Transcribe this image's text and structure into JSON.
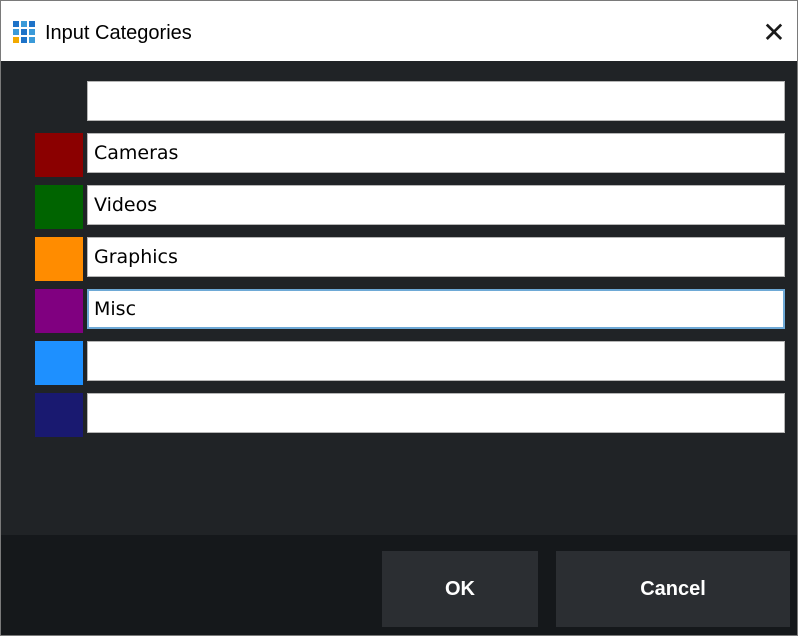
{
  "window": {
    "title": "Input Categories",
    "close_glyph": "✕",
    "icon": "grid-icon",
    "icon_colors": [
      "#1e73c8",
      "#3a9ad9",
      "#1e73c8",
      "#3a9ad9",
      "#1e73c8",
      "#3a9ad9",
      "#f2a900",
      "#1e73c8",
      "#3a9ad9"
    ]
  },
  "categories": [
    {
      "color": "",
      "value": ""
    },
    {
      "color": "#8b0000",
      "value": "Cameras"
    },
    {
      "color": "#006400",
      "value": "Videos"
    },
    {
      "color": "#ff8c00",
      "value": "Graphics"
    },
    {
      "color": "#800080",
      "value": "Misc"
    },
    {
      "color": "#1e90ff",
      "value": ""
    },
    {
      "color": "#191970",
      "value": ""
    }
  ],
  "buttons": {
    "ok_label": "OK",
    "cancel_label": "Cancel"
  }
}
